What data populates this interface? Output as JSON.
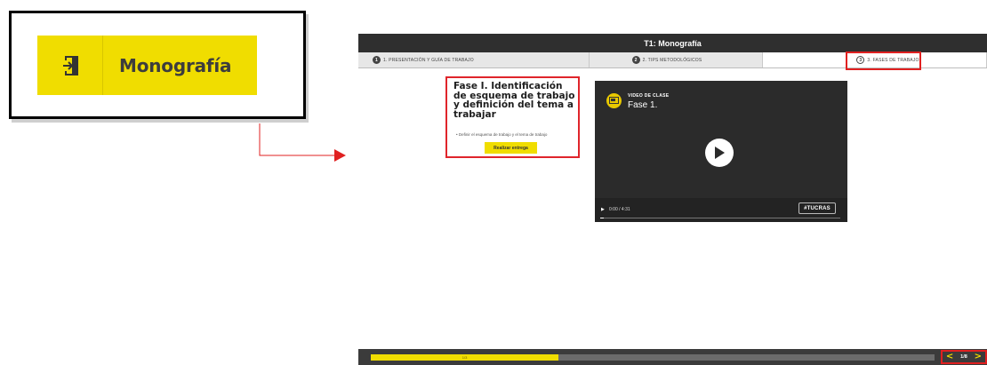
{
  "callout": {
    "title": "Monografía",
    "icon": "exit-door-icon",
    "accent": "#f0dd00"
  },
  "app": {
    "title": "T1: Monografía",
    "tabs": [
      {
        "num": "1",
        "label": "1. Presentación y guía de trabajo",
        "active": false
      },
      {
        "num": "2",
        "label": "2. Tips metodológicos",
        "active": false
      },
      {
        "num": "3",
        "label": "3. Fases de trabajo",
        "active": true
      }
    ],
    "phase": {
      "title": "Fase I. Identificación de esquema de trabajo y definición del tema a trabajar",
      "bullet": "Definir el esquema de trabajo y el tema de trabajo",
      "button": "Realizar entrega"
    },
    "video": {
      "kicker": "VIDEO DE CLASE",
      "title": "Fase 1.",
      "time": "0:00 / 4:31",
      "watermark": "#TUCRAS",
      "progress": 0
    },
    "footer": {
      "progress_text": "1/3",
      "progress_fraction": 0.333,
      "page": "1/8"
    }
  },
  "colors": {
    "highlight": "#e02020",
    "dark": "#2f2f2f"
  }
}
